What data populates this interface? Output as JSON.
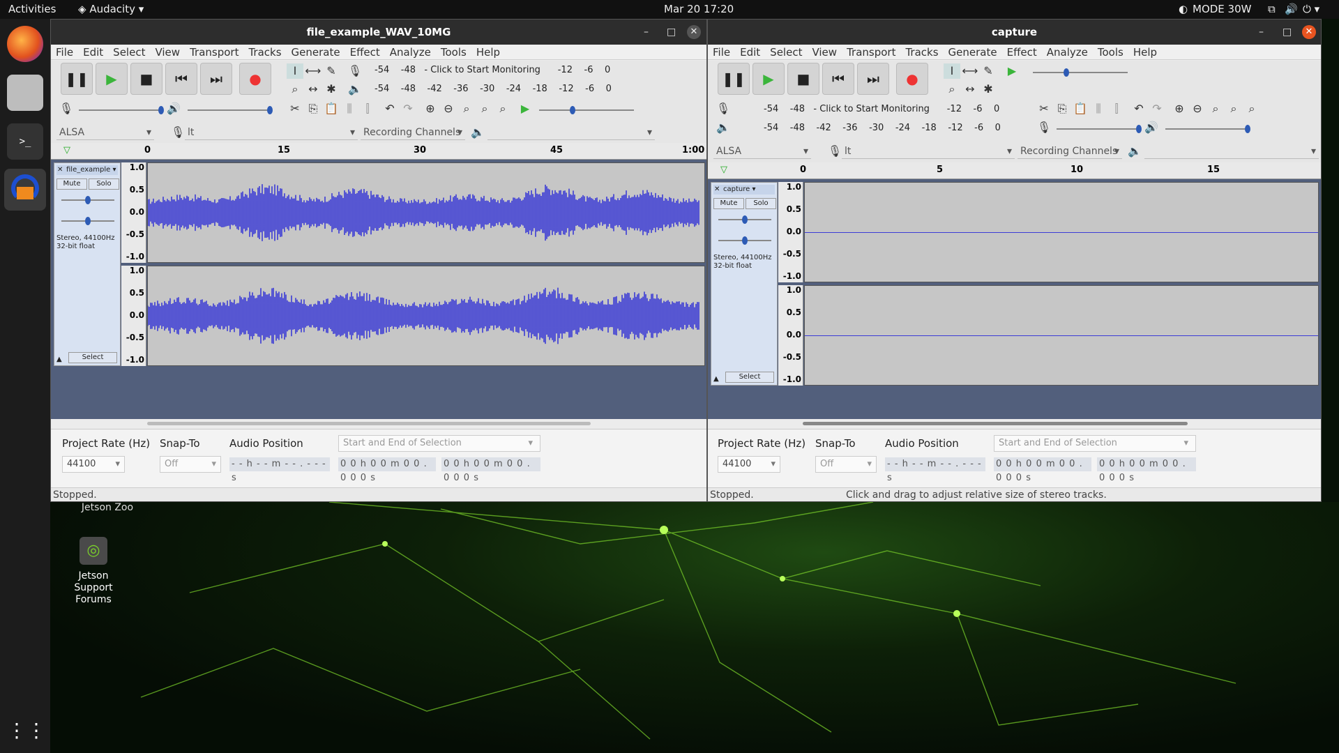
{
  "topbar": {
    "activities": "Activities",
    "app_name": "Audacity",
    "datetime": "Mar 20  17:20",
    "power_mode": "MODE 30W"
  },
  "desktop": {
    "icon_label": "Jetson Support Forums",
    "partial_label": "Jetson Zoo"
  },
  "left_window": {
    "title": "file_example_WAV_10MG",
    "menu": [
      "File",
      "Edit",
      "Select",
      "View",
      "Transport",
      "Tracks",
      "Generate",
      "Effect",
      "Analyze",
      "Tools",
      "Help"
    ],
    "monitor_text": "Click to Start Monitoring",
    "meter_scale": [
      "-54",
      "-48",
      "-42",
      "-36",
      "-30",
      "-24",
      "-18",
      "-12",
      "-6",
      "0"
    ],
    "host": "ALSA",
    "input_device": "lt",
    "rec_channels": "Recording Channels",
    "ruler": [
      "0",
      "15",
      "30",
      "45",
      "1:00"
    ],
    "track_name": "file_example",
    "mute": "Mute",
    "solo": "Solo",
    "track_info": "Stereo, 44100Hz 32-bit float",
    "select_btn": "Select",
    "amp_scale": [
      "1.0",
      "0.5",
      "0.0",
      "-0.5",
      "-1.0"
    ],
    "project_rate_label": "Project Rate (Hz)",
    "project_rate": "44100",
    "snap_to_label": "Snap-To",
    "snap_to": "Off",
    "audio_position_label": "Audio Position",
    "selection_mode": "Start and End of Selection",
    "audio_position": "- - h - - m - - . - - - s",
    "sel_start": "0 0 h 0 0 m 0 0 . 0 0 0 s",
    "sel_end": "0 0 h 0 0 m 0 0 . 0 0 0 s",
    "status": "Stopped."
  },
  "right_window": {
    "title": "capture",
    "menu": [
      "File",
      "Edit",
      "Select",
      "View",
      "Transport",
      "Tracks",
      "Generate",
      "Effect",
      "Analyze",
      "Tools",
      "Help"
    ],
    "monitor_text": "Click to Start Monitoring",
    "meter_scale": [
      "-54",
      "-48",
      "-42",
      "-36",
      "-30",
      "-24",
      "-18",
      "-12",
      "-6",
      "0"
    ],
    "host": "ALSA",
    "input_device": "lt",
    "rec_channels": "Recording Channels",
    "ruler": [
      "0",
      "5",
      "10",
      "15"
    ],
    "track_name": "capture",
    "mute": "Mute",
    "solo": "Solo",
    "track_info": "Stereo, 44100Hz 32-bit float",
    "select_btn": "Select",
    "amp_scale": [
      "1.0",
      "0.5",
      "0.0",
      "-0.5",
      "-1.0"
    ],
    "project_rate_label": "Project Rate (Hz)",
    "project_rate": "44100",
    "snap_to_label": "Snap-To",
    "snap_to": "Off",
    "audio_position_label": "Audio Position",
    "selection_mode": "Start and End of Selection",
    "audio_position": "- - h - - m - - . - - - s",
    "sel_start": "0 0 h 0 0 m 0 0 . 0 0 0 s",
    "sel_end": "0 0 h 0 0 m 0 0 . 0 0 0 s",
    "status": "Stopped.",
    "status_hint": "Click and drag to adjust relative size of stereo tracks."
  },
  "colors": {
    "waveform": "#3b3bd6",
    "record": "#e33",
    "play": "#3bb53b",
    "track_bg": "#525f7c",
    "close_button": "#e95420"
  }
}
